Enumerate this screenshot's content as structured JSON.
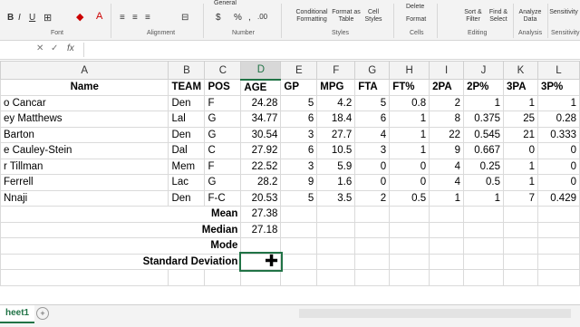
{
  "ribbon": {
    "font_group": "Font",
    "alignment_group": "Alignment",
    "number_group": "Number",
    "number_format": "General",
    "styles_group": "Styles",
    "cells_group": "Cells",
    "editing_group": "Editing",
    "analysis_group": "Analysis",
    "sensitivity_group": "Sensitivity",
    "conditional_formatting": "Conditional Formatting",
    "format_as_table": "Format as Table",
    "cell_styles": "Cell Styles",
    "delete": "Delete",
    "format": "Format",
    "sort_filter": "Sort & Filter",
    "find_select": "Find & Select",
    "analyze_data": "Analyze Data",
    "sensitivity": "Sensitivity"
  },
  "formula_bar": {
    "fx": "fx"
  },
  "columns": [
    "A",
    "B",
    "C",
    "D",
    "E",
    "F",
    "G",
    "H",
    "I",
    "J",
    "K",
    "L"
  ],
  "header_row": [
    "Name",
    "TEAM",
    "POS",
    "AGE",
    "GP",
    "MPG",
    "FTA",
    "FT%",
    "2PA",
    "2P%",
    "3PA",
    "3P%"
  ],
  "rows": [
    [
      "o Cancar",
      "Den",
      "F",
      "24.28",
      "5",
      "4.2",
      "5",
      "0.8",
      "2",
      "1",
      "1",
      "1"
    ],
    [
      "ey Matthews",
      "Lal",
      "G",
      "34.77",
      "6",
      "18.4",
      "6",
      "1",
      "8",
      "0.375",
      "25",
      "0.28"
    ],
    [
      "Barton",
      "Den",
      "G",
      "30.54",
      "3",
      "27.7",
      "4",
      "1",
      "22",
      "0.545",
      "21",
      "0.333"
    ],
    [
      "e Cauley-Stein",
      "Dal",
      "C",
      "27.92",
      "6",
      "10.5",
      "3",
      "1",
      "9",
      "0.667",
      "0",
      "0"
    ],
    [
      "r Tillman",
      "Mem",
      "F",
      "22.52",
      "3",
      "5.9",
      "0",
      "0",
      "4",
      "0.25",
      "1",
      "0"
    ],
    [
      "Ferrell",
      "Lac",
      "G",
      "28.2",
      "9",
      "1.6",
      "0",
      "0",
      "4",
      "0.5",
      "1",
      "0"
    ],
    [
      "Nnaji",
      "Den",
      "F-C",
      "20.53",
      "5",
      "3.5",
      "2",
      "0.5",
      "1",
      "1",
      "7",
      "0.429"
    ]
  ],
  "stats": [
    {
      "label": "Mean",
      "value": "27.38"
    },
    {
      "label": "Median",
      "value": "27.18"
    },
    {
      "label": "Mode",
      "value": ""
    },
    {
      "label": "Standard Deviation",
      "value": ""
    }
  ],
  "sheet_tab": "heet1",
  "add_sheet": "+",
  "accent_color": "#217346"
}
